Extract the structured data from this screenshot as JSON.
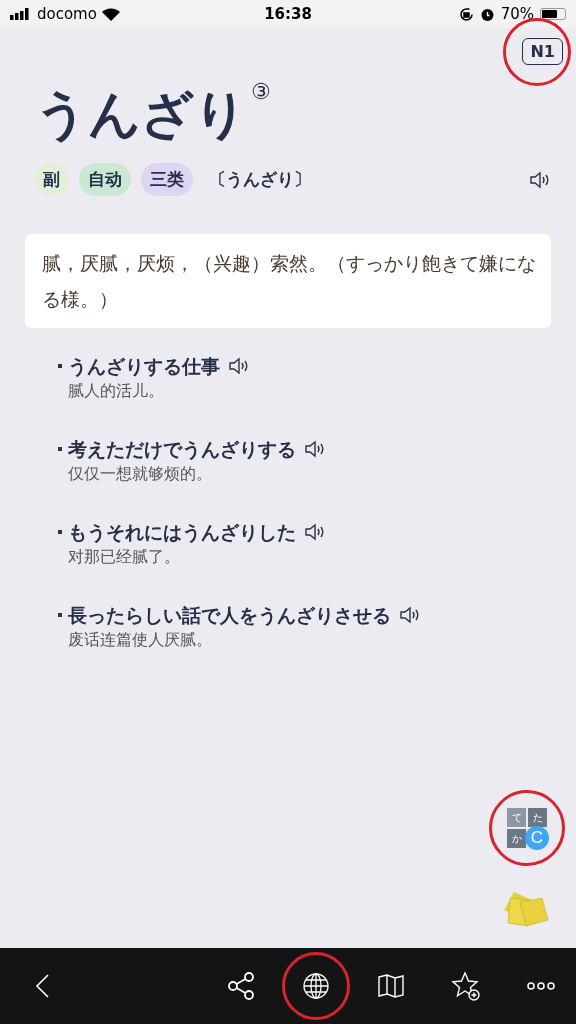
{
  "status_bar": {
    "carrier": "docomo",
    "time": "16:38",
    "battery": "70%"
  },
  "level_badge": {
    "label": "N1",
    "circled": true
  },
  "word": {
    "text": "うんざり",
    "accent": "③"
  },
  "tags": [
    {
      "label": "副",
      "color": "#e3f0d8"
    },
    {
      "label": "自动",
      "color": "#cbe8d3"
    },
    {
      "label": "三类",
      "color": "#dcd5f3"
    }
  ],
  "reading": "〔うんざり〕",
  "definition": "腻，厌腻，厌烦，（兴趣）索然。（すっかり飽きて嫌になる様。）",
  "examples": [
    {
      "ja": "うんざりする仕事",
      "zh": "腻人的活儿。"
    },
    {
      "ja": "考えただけでうんざりする",
      "zh": "仅仅一想就够烦的。"
    },
    {
      "ja": "もうそれにはうんざりした",
      "zh": "对那已经腻了。"
    },
    {
      "ja": "長ったらしい話で人をうんざりさせる",
      "zh": "废话连篇使人厌腻。"
    }
  ],
  "kana_button": {
    "letter": "C",
    "kana": [
      "て",
      "た",
      "か"
    ],
    "circled": true
  },
  "toolbar": [
    {
      "kind": "back",
      "circled": false
    },
    {
      "kind": "share",
      "circled": false
    },
    {
      "kind": "globe",
      "circled": true
    },
    {
      "kind": "map",
      "circled": false
    },
    {
      "kind": "favorite",
      "circled": false
    },
    {
      "kind": "more",
      "circled": false
    }
  ]
}
